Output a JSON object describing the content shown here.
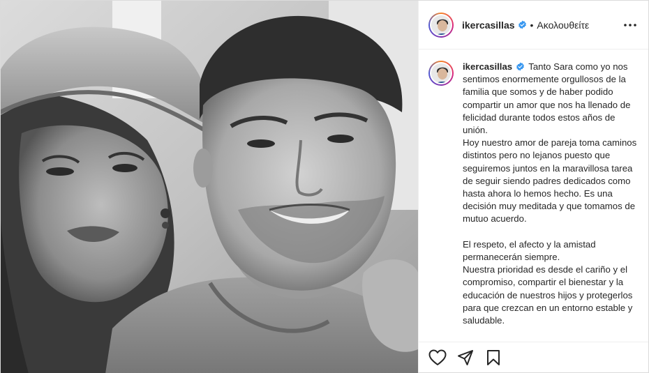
{
  "header": {
    "username": "ikercasillas",
    "separator": "•",
    "follow_status": "Ακολουθείτε"
  },
  "caption": {
    "username": "ikercasillas",
    "paragraphs": [
      "Tanto Sara como yo nos sentimos enormemente orgullosos de la familia que somos y de haber podido compartir un amor que nos ha llenado de felicidad durante todos estos años de unión.",
      "Hoy nuestro amor de pareja toma caminos distintos pero no lejanos puesto que seguiremos juntos en la maravillosa tarea de seguir siendo padres dedicados como hasta ahora lo hemos hecho. Es una decisión muy meditada y que tomamos de mutuo acuerdo.",
      "",
      "El respeto, el afecto y la amistad permanecerán siempre.",
      "Nuestra prioridad es desde el cariño y el compromiso, compartir el bienestar y la educación de nuestros hijos y protegerlos para que crezcan en un entorno estable y saludable."
    ]
  },
  "icons": {
    "verified": "verified-badge-icon",
    "more": "more-options-icon",
    "like": "heart-icon",
    "share": "paper-plane-icon",
    "save": "bookmark-icon"
  },
  "colors": {
    "verified": "#3897f0",
    "border": "#dbdbdb",
    "text": "#262626"
  }
}
